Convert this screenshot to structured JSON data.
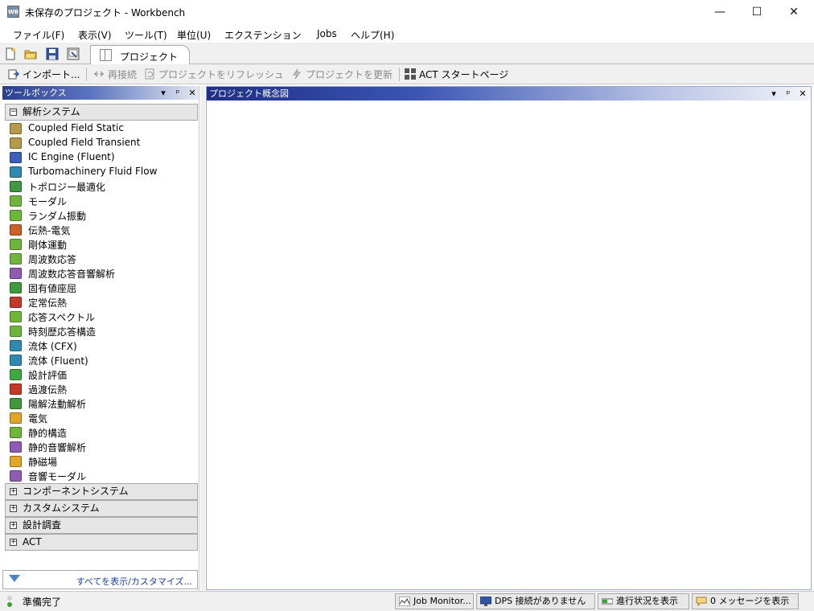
{
  "window": {
    "app_icon": "WB",
    "title": "未保存のプロジェクト - Workbench",
    "minimize": "—",
    "maximize": "☐",
    "close": "✕"
  },
  "menu": {
    "items": [
      "ファイル(F)",
      "表示(V)",
      "ツール(T)",
      "単位(U)",
      "エクステンション",
      "Jobs",
      "ヘルプ(H)"
    ]
  },
  "tabs": {
    "project_tab_label": "プロジェクト",
    "toolbar_icons": [
      "new-file-icon",
      "open-folder-icon",
      "save-icon",
      "save-as-icon"
    ]
  },
  "toolbar": {
    "import": "インポート...",
    "reconnect": "再接続",
    "refresh": "プロジェクトをリフレッシュ",
    "update": "プロジェクトを更新",
    "act_start": "ACT スタートページ"
  },
  "toolbox": {
    "title": "ツールボックス",
    "controls": [
      "▾",
      "ᵖ",
      "✕"
    ],
    "analysis_category": "解析システム",
    "analysis_systems": [
      {
        "label": "Coupled Field Static",
        "icon": "coupled-field-icon",
        "color": "#b59a4a"
      },
      {
        "label": "Coupled Field Transient",
        "icon": "coupled-field-icon",
        "color": "#b59a4a"
      },
      {
        "label": "IC Engine (Fluent)",
        "icon": "ic-engine-icon",
        "color": "#3d5fb8"
      },
      {
        "label": "Turbomachinery Fluid Flow",
        "icon": "turbo-icon",
        "color": "#2e8ab0"
      },
      {
        "label": "トポロジー最適化",
        "icon": "topology-icon",
        "color": "#3f9a3f"
      },
      {
        "label": "モーダル",
        "icon": "modal-icon",
        "color": "#6fb53b"
      },
      {
        "label": "ランダム振動",
        "icon": "random-vibration-icon",
        "color": "#6fb53b"
      },
      {
        "label": "伝熱-電気",
        "icon": "thermal-electric-icon",
        "color": "#c9632a"
      },
      {
        "label": "剛体運動",
        "icon": "rigid-dynamics-icon",
        "color": "#6fb53b"
      },
      {
        "label": "周波数応答",
        "icon": "harmonic-icon",
        "color": "#6fb53b"
      },
      {
        "label": "周波数応答音響解析",
        "icon": "harmonic-acoustics-icon",
        "color": "#8e5cb4"
      },
      {
        "label": "固有値座屈",
        "icon": "buckling-icon",
        "color": "#3f9a3f"
      },
      {
        "label": "定常伝熱",
        "icon": "steady-thermal-icon",
        "color": "#c23a2a"
      },
      {
        "label": "応答スペクトル",
        "icon": "response-spectrum-icon",
        "color": "#6fb53b"
      },
      {
        "label": "時刻歴応答構造",
        "icon": "transient-structural-icon",
        "color": "#6fb53b"
      },
      {
        "label": "流体 (CFX)",
        "icon": "cfx-icon",
        "color": "#2e8ab0"
      },
      {
        "label": "流体 (Fluent)",
        "icon": "fluent-icon",
        "color": "#2e8ab0"
      },
      {
        "label": "設計評価",
        "icon": "design-assessment-icon",
        "color": "#3fa83f"
      },
      {
        "label": "過渡伝熱",
        "icon": "transient-thermal-icon",
        "color": "#c23a2a"
      },
      {
        "label": "陽解法動解析",
        "icon": "explicit-dynamics-icon",
        "color": "#3f9a3f"
      },
      {
        "label": "電気",
        "icon": "electric-icon",
        "color": "#e0a62a"
      },
      {
        "label": "静的構造",
        "icon": "static-structural-icon",
        "color": "#6fb53b"
      },
      {
        "label": "静的音響解析",
        "icon": "static-acoustics-icon",
        "color": "#8e5cb4"
      },
      {
        "label": "静磁場",
        "icon": "magnetostatic-icon",
        "color": "#e0a62a"
      },
      {
        "label": "音響モーダル",
        "icon": "modal-acoustics-icon",
        "color": "#8e5cb4"
      }
    ],
    "collapsed_categories": [
      "コンポーネントシステム",
      "カスタムシステム",
      "設計調査",
      "ACT"
    ],
    "footer_link": "すべてを表示/カスタマイズ..."
  },
  "schematic": {
    "title": "プロジェクト概念図",
    "controls": [
      "▾",
      "ᵖ",
      "✕"
    ]
  },
  "status": {
    "text": "準備完了",
    "buttons": [
      "Job Monitor...",
      "DPS 接続がありません",
      "進行状況を表示",
      "0 メッセージを表示"
    ]
  }
}
